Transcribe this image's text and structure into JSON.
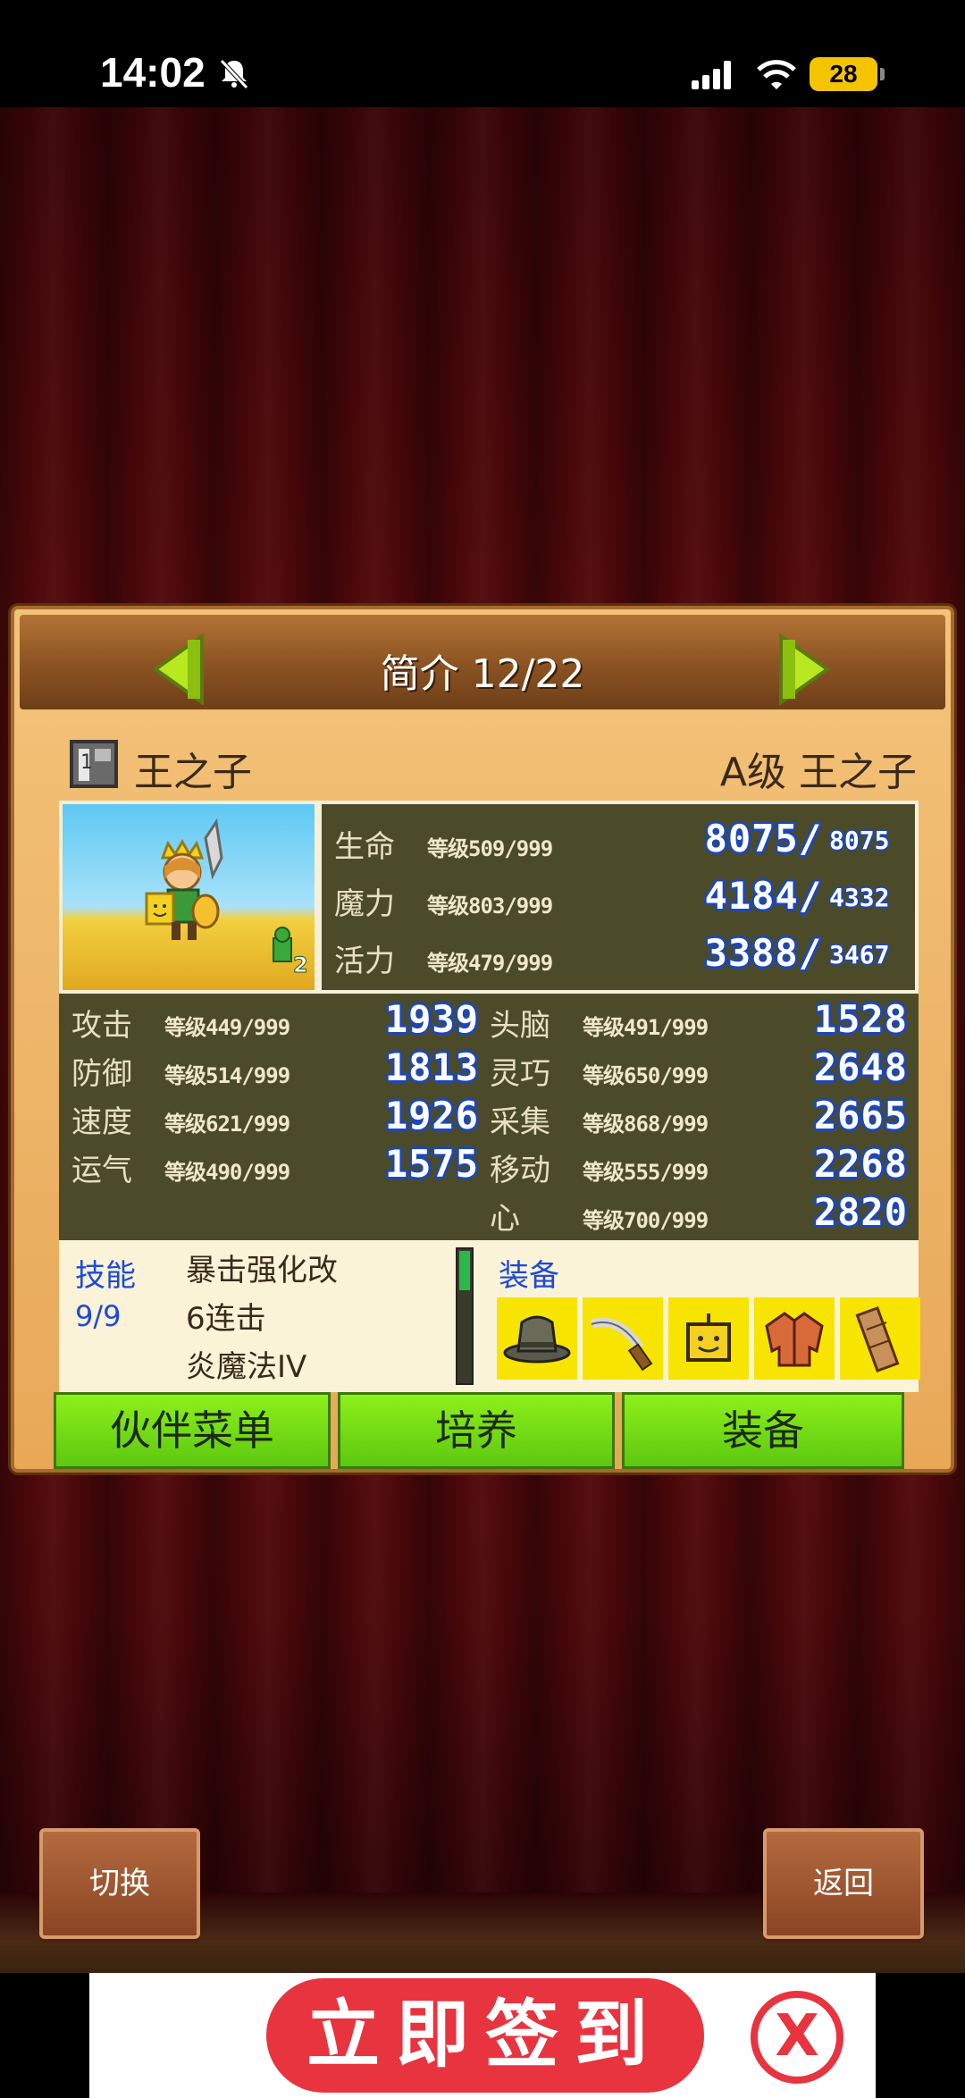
{
  "status_bar": {
    "time": "14:02",
    "battery": "28"
  },
  "panel": {
    "title": "简介 12/22",
    "name": "王之子",
    "rank_label": "A级 王之子",
    "portrait_badge": "2",
    "vitals": [
      {
        "label": "生命",
        "level": "等级509/999",
        "value": "8075/",
        "max": "8075"
      },
      {
        "label": "魔力",
        "level": "等级803/999",
        "value": "4184/",
        "max": "4332"
      },
      {
        "label": "活力",
        "level": "等级479/999",
        "value": "3388/",
        "max": "3467"
      }
    ],
    "stats_left": [
      {
        "label": "攻击",
        "level": "等级449/999",
        "value": "1939"
      },
      {
        "label": "防御",
        "level": "等级514/999",
        "value": "1813"
      },
      {
        "label": "速度",
        "level": "等级621/999",
        "value": "1926"
      },
      {
        "label": "运气",
        "level": "等级490/999",
        "value": "1575"
      }
    ],
    "stats_right": [
      {
        "label": "头脑",
        "level": "等级491/999",
        "value": "1528"
      },
      {
        "label": "灵巧",
        "level": "等级650/999",
        "value": "2648"
      },
      {
        "label": "采集",
        "level": "等级868/999",
        "value": "2665"
      },
      {
        "label": "移动",
        "level": "等级555/999",
        "value": "2268"
      },
      {
        "label": "心",
        "level": "等级700/999",
        "value": "2820"
      }
    ],
    "skills_title": "技能",
    "skills_count": "9/9",
    "skills": [
      "暴击强化改",
      "6连击",
      "炎魔法IV"
    ],
    "skill_gauge_fraction": 0.3,
    "equip_title": "装备",
    "equipment_icons": [
      "hat-icon",
      "sword-icon",
      "accessory-icon",
      "armor-icon",
      "scroll-icon"
    ],
    "buttons": {
      "partner_menu": "伙伴菜单",
      "train": "培养",
      "equip": "装备"
    }
  },
  "footer": {
    "switch": "切换",
    "back": "返回"
  },
  "ad": {
    "text": "立即签到",
    "close": "X"
  }
}
